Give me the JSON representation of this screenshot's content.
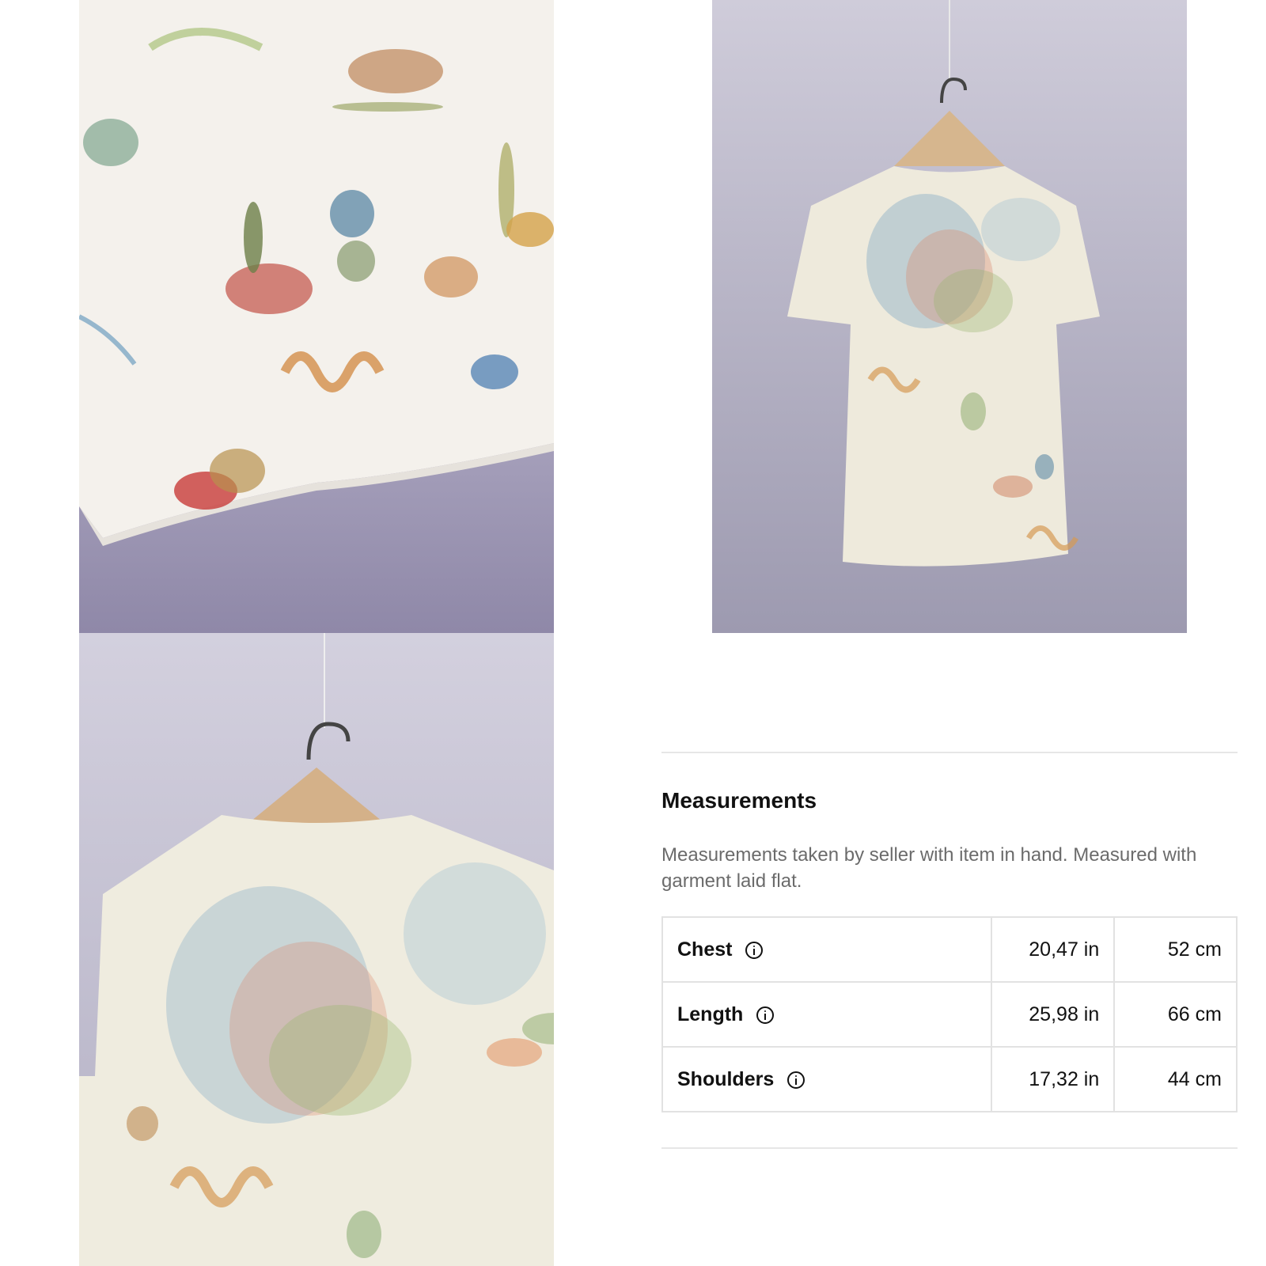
{
  "gallery": {
    "images": [
      {
        "name": "detail-hem-print"
      },
      {
        "name": "back-full-on-hanger"
      },
      {
        "name": "back-closeup-on-hanger"
      }
    ]
  },
  "measurements": {
    "title": "Measurements",
    "description": "Measurements taken by seller with item in hand. Measured with garment laid flat.",
    "rows": [
      {
        "label": "Chest",
        "inches": "20,47 in",
        "cm": "52 cm",
        "icon": "info-icon"
      },
      {
        "label": "Length",
        "inches": "25,98 in",
        "cm": "66 cm",
        "icon": "info-icon"
      },
      {
        "label": "Shoulders",
        "inches": "17,32 in",
        "cm": "44 cm",
        "icon": "info-icon"
      }
    ]
  }
}
